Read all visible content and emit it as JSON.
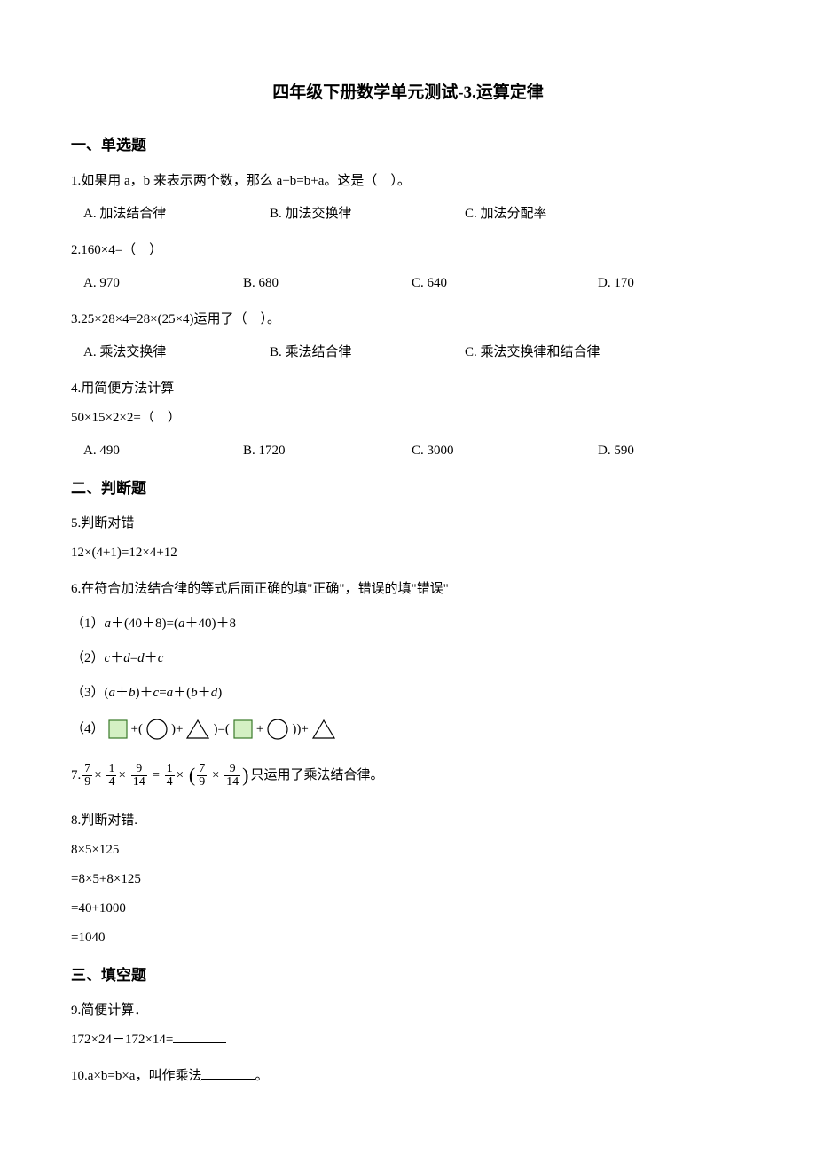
{
  "title": "四年级下册数学单元测试-3.运算定律",
  "sections": {
    "s1": "一、单选题",
    "s2": "二、判断题",
    "s3": "三、填空题"
  },
  "q1": {
    "stem": "1.如果用 a，b 来表示两个数，那么 a+b=b+a。这是（　）。",
    "A": "A. 加法结合律",
    "B": "B. 加法交换律",
    "C": "C. 加法分配率"
  },
  "q2": {
    "stem": "2.160×4=（　）",
    "A": "A. 970",
    "B": "B. 680",
    "C": "C. 640",
    "D": "D. 170"
  },
  "q3": {
    "stem": "3.25×28×4=28×(25×4)运用了（　）。",
    "A": "A. 乘法交换律",
    "B": "B. 乘法结合律",
    "C": "C. 乘法交换律和结合律"
  },
  "q4": {
    "line1": "4.用简便方法计算",
    "line2": "50×15×2×2=（　）",
    "A": "A. 490",
    "B": "B. 1720",
    "C": "C. 3000",
    "D": "D. 590"
  },
  "q5": {
    "line1": "5.判断对错",
    "line2": "12×(4+1)=12×4+12"
  },
  "q6": {
    "stem": "6.在符合加法结合律的等式后面正确的填\"正确\"，错误的填\"错误\"",
    "p1_prefix": "（1）",
    "p2_prefix": "（2）",
    "p3_prefix": "（3）",
    "p4_prefix": "（4）"
  },
  "q7": {
    "prefix": "7.",
    "tail": "只运用了乘法结合律。",
    "f1n": "7",
    "f1d": "9",
    "f2n": "1",
    "f2d": "4",
    "f3n": "9",
    "f3d": "14",
    "f4n": "1",
    "f4d": "4",
    "f5n": "7",
    "f5d": "9",
    "f6n": "9",
    "f6d": "14"
  },
  "q8": {
    "line1": "8.判断对错.",
    "line2": "8×5×125",
    "line3": "=8×5+8×125",
    "line4": "=40+1000",
    "line5": "=1040"
  },
  "q9": {
    "line1": "9.简便计算．",
    "line2": "172×24－172×14="
  },
  "q10": {
    "pre": "10.a×b=b×a，叫作乘法",
    "post": "。"
  }
}
